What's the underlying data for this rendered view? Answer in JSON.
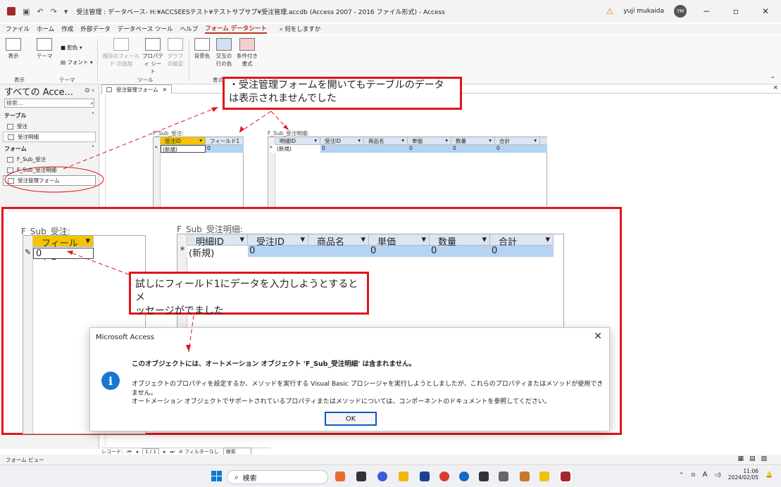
{
  "window": {
    "title": "受注管理 : データベース- H:¥ACCSEESテスト¥テストサブサブ¥受注管理.accdb (Access 2007 - 2016 ファイル形式) - Access",
    "user": "yuji mukaida",
    "user_initials": "YM"
  },
  "menu": [
    "ファイル",
    "ホーム",
    "作成",
    "外部データ",
    "データベース ツール",
    "ヘルプ",
    "フォーム データシート"
  ],
  "menu_active": "フォーム データシート",
  "menu_tell": "何をしますか",
  "ribbon": {
    "view": "表示",
    "theme": "テーマ",
    "colors": "配色",
    "fonts": "フォント",
    "add_field": "既存のフィールド の追加",
    "property_sheet": "プロパティ シート",
    "graph_settings": "グラフ の設定",
    "bg_color": "背景色",
    "alt_row": "交互の 行の色",
    "cond_format": "条件付き 書式",
    "group_view": "表示",
    "group_theme": "テーマ",
    "group_tools": "ツール",
    "group_format": "書式設定"
  },
  "nav": {
    "title": "すべての Acce...",
    "search_placeholder": "検索...",
    "section_tables": "テーブル",
    "section_forms": "フォーム",
    "tables": [
      "受注",
      "受注明細"
    ],
    "forms": [
      "F_Sub_受注",
      "F_Sub_受注明細",
      "受注管理フォーム"
    ]
  },
  "doc": {
    "tab_label": "受注管理フォーム",
    "sub1_caption": "F_Sub_受注:",
    "sub1_headers": [
      "受注ID",
      "フィールド1"
    ],
    "sub1_row": [
      "(新規)",
      "0"
    ],
    "sub2_caption": "F_Sub_受注明細:",
    "sub2_headers": [
      "明細ID",
      "受注ID",
      "商品名",
      "単価",
      "数量",
      "合計"
    ],
    "sub2_row": [
      "(新規)",
      "0",
      "",
      "0",
      "0",
      "0"
    ]
  },
  "zoom": {
    "sub1_caption": "F_Sub_受注:",
    "sub1_header": "フィールド1",
    "sub1_value": "0",
    "sub2_caption": "F_Sub_受注明細:",
    "sub2_headers": [
      "明細ID",
      "受注ID",
      "商品名",
      "単価",
      "数量",
      "合計"
    ],
    "sub2_row": [
      "(新規)",
      "0",
      "",
      "0",
      "0",
      "0"
    ]
  },
  "callouts": {
    "c1_line1": "・受注管理フォームを開いてもテーブルのデータ",
    "c1_line2": "は表示されませんでした",
    "c2_line1": "試しにフィールド1にデータを入力しようとするとメ",
    "c2_line2": "ッセージがでました"
  },
  "dialog": {
    "title": "Microsoft Access",
    "main": "このオブジェクトには、オートメーション オブジェクト 'F_Sub_受注明細' は含まれません。",
    "line2": "オブジェクトのプロパティを設定するか、メソッドを実行する Visual Basic プロシージャを実行しようとしましたが、これらのプロパティまたはメソッドが使用できません。",
    "line3": "オートメーション オブジェクトでサポートされているプロパティまたはメソッドについては、コンポーネントのドキュメントを参照してください。",
    "ok": "OK"
  },
  "record_nav": {
    "label": "レコード:",
    "position": "1 / 1",
    "filter": "フィルターなし",
    "search": "検索"
  },
  "status": "フォーム ビュー",
  "taskbar": {
    "search": "検索",
    "time": "11:06",
    "date": "2024/02/05",
    "ime": "A"
  }
}
